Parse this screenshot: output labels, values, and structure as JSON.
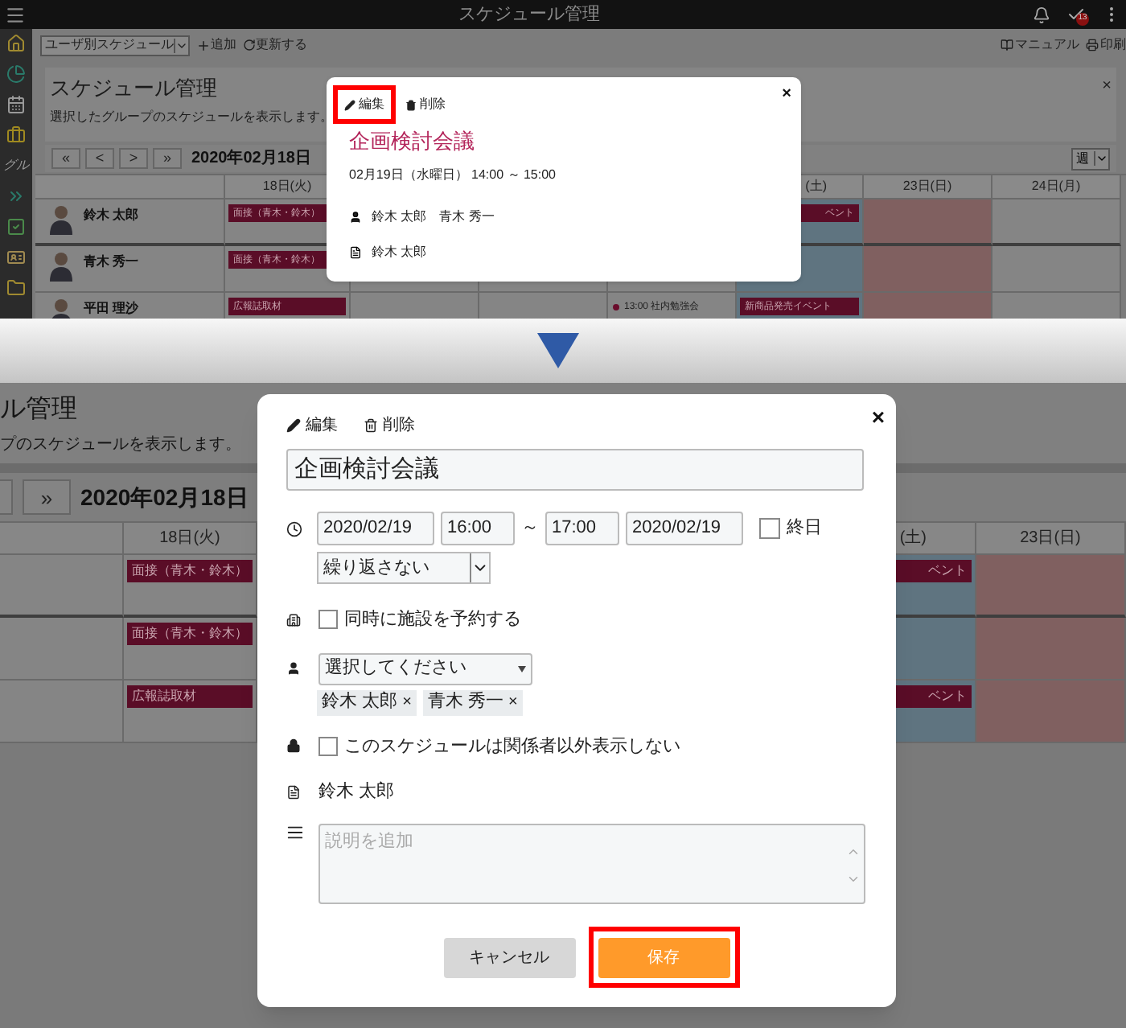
{
  "top_screen": {
    "app_title": "スケジュール管理",
    "task_badge": "13",
    "sidebar_label": "グル",
    "toolbar": {
      "view": "ユーザ別スケジュール",
      "add": "追加",
      "refresh": "更新する",
      "manual": "マニュアル",
      "print": "印刷"
    },
    "panel": {
      "title": "スケジュール管理",
      "subtitle": "選択したグループのスケジュールを表示します。",
      "close": "×"
    },
    "nav": {
      "buttons": [
        "«",
        "<",
        ">",
        "»"
      ],
      "date": "2020年02月18日",
      "range": "週"
    },
    "columns": [
      {
        "label": "18日(火)",
        "kind": "weekday"
      },
      {
        "kind": "weekday"
      },
      {
        "kind": "weekday"
      },
      {
        "kind": "weekday"
      },
      {
        "label": "(土)",
        "kind": "saturday"
      },
      {
        "label": "23日(日)",
        "kind": "sunday"
      },
      {
        "label": "24日(月)",
        "kind": "weekday"
      }
    ],
    "rows": [
      {
        "name": "鈴木 太郎",
        "cells": [
          {
            "events": [
              {
                "text": "面接（青木・鈴木）",
                "kind": "bar"
              }
            ]
          },
          {},
          {},
          {},
          {
            "events": [
              {
                "text": "ベント",
                "kind": "partial-bar"
              }
            ]
          },
          {},
          {}
        ]
      },
      {
        "name": "青木 秀一",
        "cells": [
          {
            "events": [
              {
                "text": "面接（青木・鈴木）",
                "kind": "bar"
              }
            ]
          },
          {},
          {},
          {},
          {},
          {},
          {}
        ]
      },
      {
        "name": "平田 理沙",
        "cells": [
          {
            "events": [
              {
                "text": "広報誌取材",
                "kind": "bar"
              }
            ]
          },
          {},
          {},
          {
            "events": [
              {
                "text": "13:00 社内勉強会",
                "kind": "dot"
              }
            ]
          },
          {
            "events": [
              {
                "text": "新商品発売イベント",
                "kind": "bar"
              }
            ]
          },
          {},
          {}
        ]
      }
    ],
    "popup": {
      "actions": [
        {
          "label": "編集",
          "kind": "edit",
          "highlighted": true
        },
        {
          "label": "削除",
          "kind": "delete",
          "highlighted": false
        }
      ],
      "close": "×",
      "title": "企画検討会議",
      "when": "02月19日（水曜日） 14:00 ～ 15:00",
      "attendees": "鈴木 太郎　青木 秀一",
      "owner": "鈴木 太郎"
    }
  },
  "bottom_screen": {
    "panel": {
      "title": "ル管理",
      "subtitle": "プのスケジュールを表示します。"
    },
    "nav": {
      "button": "»",
      "date": "2020年02月18日"
    },
    "columns": [
      {
        "label": "18日(火)",
        "kind": "weekday"
      },
      {
        "kind": "weekday"
      },
      {
        "label": "(土)",
        "kind": "saturday"
      },
      {
        "label": "23日(日)",
        "kind": "sunday"
      }
    ],
    "rows": [
      {
        "cells": [
          {
            "events": [
              {
                "text": "面接（青木・鈴木）",
                "kind": "bar"
              }
            ]
          },
          {},
          {
            "events": [
              {
                "text": "ベント",
                "kind": "partial-bar"
              }
            ]
          },
          {}
        ]
      },
      {
        "cells": [
          {
            "events": [
              {
                "text": "面接（青木・鈴木）",
                "kind": "bar"
              }
            ]
          },
          {},
          {},
          {}
        ]
      },
      {
        "cells": [
          {
            "events": [
              {
                "text": "広報誌取材",
                "kind": "bar"
              }
            ]
          },
          {},
          {
            "events": [
              {
                "text": "ベント",
                "kind": "partial-bar"
              }
            ]
          },
          {}
        ]
      }
    ],
    "dialog": {
      "actions": [
        {
          "label": "編集",
          "kind": "edit",
          "highlighted": false
        },
        {
          "label": "削除",
          "kind": "delete",
          "highlighted": false
        }
      ],
      "close": "×",
      "title": "企画検討会議",
      "start_date": "2020/02/19",
      "start_time": "16:00",
      "separator": "～",
      "end_time": "17:00",
      "end_date": "2020/02/19",
      "all_day": {
        "label": "終日",
        "checked": false
      },
      "repeat": "繰り返さない",
      "facility": {
        "label": "同時に施設を予約する",
        "checked": false
      },
      "attendee_select": "選択してください",
      "attendees": [
        {
          "name": "鈴木 太郎",
          "remove": "×"
        },
        {
          "name": "青木 秀一",
          "remove": "×"
        }
      ],
      "private": {
        "label": "このスケジュールは関係者以外表示しない",
        "checked": false
      },
      "owner": "鈴木 太郎",
      "description": {
        "placeholder": "説明を追加"
      },
      "buttons": [
        {
          "label": "キャンセル",
          "kind": "secondary",
          "highlighted": false
        },
        {
          "label": "保存",
          "kind": "primary",
          "highlighted": true
        }
      ]
    }
  }
}
